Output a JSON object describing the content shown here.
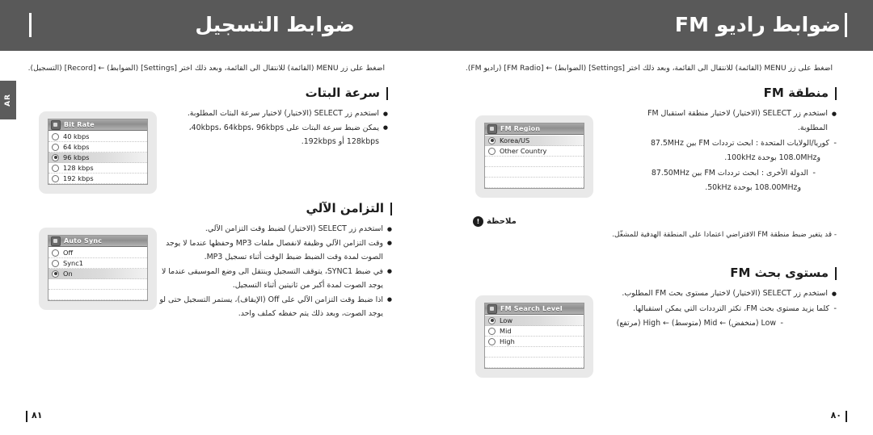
{
  "document": {
    "language_tab": "AR"
  },
  "left_page": {
    "header_title": "ضوابط التسجيل",
    "intro": "اضغط على زر MENU (القائمة) للانتقال الى القائمة، وبعد ذلك اختر [Settings] (الضوابط) ← [Record] (التسجيل).",
    "folio": "٨١",
    "sections": [
      {
        "title": "سرعة البتات",
        "bullets": [
          "استخدم زر SELECT (الاختيار) لاختيار سرعة البتات المطلوبة.",
          "يمكن ضبط سرعة البتات على 40kbps، 64kbps، 96kbps،",
          "128kbps أو 192kbps."
        ],
        "screen": {
          "icon": "bitrate-icon",
          "title": "Bit Rate",
          "rows": [
            {
              "label": "40 kbps",
              "selected": false
            },
            {
              "label": "64 kbps",
              "selected": false
            },
            {
              "label": "96 kbps",
              "selected": true
            },
            {
              "label": "128 kbps",
              "selected": false
            },
            {
              "label": "192 kbps",
              "selected": false
            }
          ]
        }
      },
      {
        "title": "التزامن الآلي",
        "bullets": [
          "استخدم زر SELECT (الاختيار) لضبط وقت التزامن الآلي.",
          "وقت التزامن الآلي وظيفة لانفصال ملفات MP3 وحفظها عندما لا يوجد",
          "الصوت لمدة وقت الضبط ضبط الوقت أثناء تسجيل MP3.",
          "في ضبط SYNC1، يتوقف التسجيل وينتقل الى وضع الموسيقى عندما لا",
          "يوجد الصوت لمدة أكبر من ثانيتين أثناء التسجيل.",
          "اذا ضبط وقت التزامن الآلي على Off (الإيقاف)، يستمر التسجيل حتى لو لم",
          "يوجد الصوت، وبعد ذلك يتم حفظه كملف واحد."
        ],
        "screen": {
          "icon": "auto-sync-icon",
          "title": "Auto Sync",
          "rows": [
            {
              "label": "Off",
              "selected": false
            },
            {
              "label": "Sync1",
              "selected": false
            },
            {
              "label": "On",
              "selected": true
            }
          ]
        }
      }
    ]
  },
  "right_page": {
    "header_title": "ضوابط راديو FM",
    "intro": "اضغط على زر MENU (القائمة) للانتقال الى القائمة، وبعد ذلك اختر [Settings] (الضوابط) ← [FM Radio] (راديو FM).",
    "folio": "٨٠",
    "sections": [
      {
        "title": "منطقة FM",
        "bullets": [
          "استخدم زر SELECT (الاختيار) لاختيار منطقة استقبال FM",
          "المطلوبة.",
          "كوريا/الولايات المتحدة : ابحث ترددات FM بين 87.5MHz",
          "و108.0MHz بوحدة 100kHz.",
          "الدولة الأخرى : ابحث ترددات FM بين 87.50MHz",
          "و108.00MHz بوحدة 50kHz."
        ],
        "screen": {
          "icon": "fm-region-icon",
          "title": "FM Region",
          "rows": [
            {
              "label": "Korea/US",
              "selected": true
            },
            {
              "label": "Other Country",
              "selected": false
            }
          ]
        }
      },
      {
        "title": "مستوى بحث FM",
        "bullets": [
          "استخدم زر SELECT (الاختيار) لاختيار مستوى بحث FM المطلوب.",
          "كلما يزيد مستوى بحث FM، تكثر الترددات التي يمكن استقبالها.",
          "Low (منخفض) ← Mid (متوسط) ← High (مرتفع)"
        ],
        "screen": {
          "icon": "fm-search-level-icon",
          "title": "FM Search Level",
          "rows": [
            {
              "label": "Low",
              "selected": true
            },
            {
              "label": "Mid",
              "selected": false
            },
            {
              "label": "High",
              "selected": false
            }
          ]
        }
      }
    ],
    "note": {
      "icon": "note-icon",
      "label": "ملاحظة",
      "body": "- قد يتغير ضبط منطقة FM الافتراضي اعتمادا على المنطقة الهدفية للمشغّل."
    }
  }
}
